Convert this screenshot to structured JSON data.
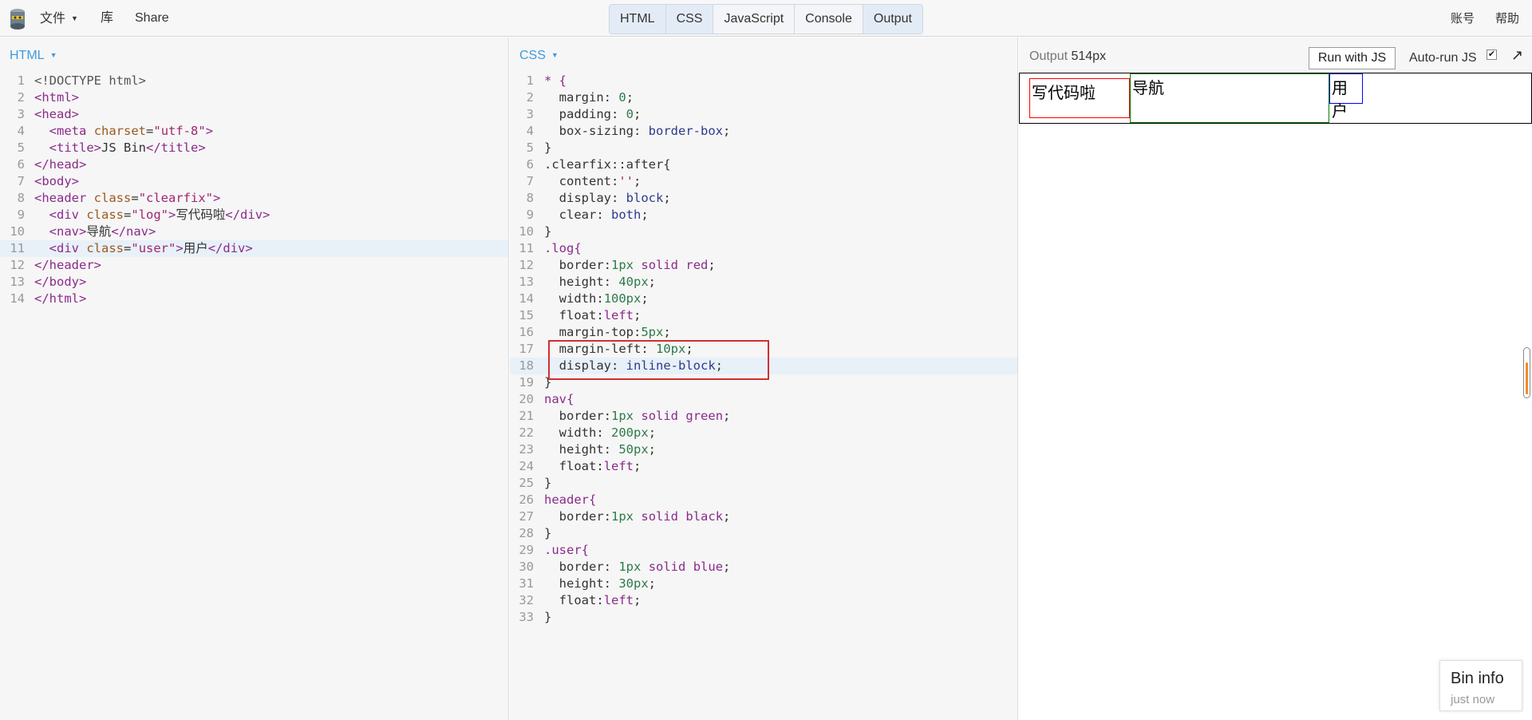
{
  "topbar": {
    "menu_file": "文件",
    "menu_library": "库",
    "menu_share": "Share",
    "tabs": [
      "HTML",
      "CSS",
      "JavaScript",
      "Console",
      "Output"
    ],
    "account": "账号",
    "help": "帮助",
    "logo_icon": "jsbin-logo-icon"
  },
  "html_panel": {
    "title": "HTML",
    "lines": [
      {
        "n": "1"
      },
      {
        "n": "2"
      },
      {
        "n": "3"
      },
      {
        "n": "4"
      },
      {
        "n": "5"
      },
      {
        "n": "6"
      },
      {
        "n": "7"
      },
      {
        "n": "8"
      },
      {
        "n": "9"
      },
      {
        "n": "10"
      },
      {
        "n": "11"
      },
      {
        "n": "12"
      },
      {
        "n": "13"
      },
      {
        "n": "14"
      }
    ],
    "code": {
      "l1": "<!DOCTYPE html>",
      "l2": "<html>",
      "l3": "<head>",
      "l4_tag": "<meta",
      "l4_attr": "charset",
      "l4_val": "\"utf-8\"",
      "l4_end": ">",
      "l5_open": "<title>",
      "l5_text": "JS Bin",
      "l5_close": "</title>",
      "l6": "</head>",
      "l7": "<body>",
      "l8_tag": "<header",
      "l8_attr": "class",
      "l8_val": "\"clearfix\"",
      "l8_end": ">",
      "l9_tag": "<div",
      "l9_attr": "class",
      "l9_val": "\"log\"",
      "l9_end": ">",
      "l9_text": "写代码啦",
      "l9_close": "</div>",
      "l10_open": "<nav>",
      "l10_text": "导航",
      "l10_close": "</nav>",
      "l11_tag": "<div",
      "l11_attr": "class",
      "l11_val": "\"user\"",
      "l11_end": ">",
      "l11_text": "用户",
      "l11_close": "</div>",
      "l12": "</header>",
      "l13": "</body>",
      "l14": "</html>"
    }
  },
  "css_panel": {
    "title": "CSS",
    "code": [
      "* {",
      "  margin: 0;",
      "  padding: 0;",
      "  box-sizing: border-box;",
      "}",
      ".clearfix::after{",
      "  content:'';",
      "  display: block;",
      "  clear: both;",
      "}",
      ".log{",
      "  border:1px solid red;",
      "  height: 40px;",
      "  width:100px;",
      "  float:left;",
      "  margin-top:5px;",
      "  margin-left: 10px;",
      "  display: inline-block;",
      "}",
      "nav{",
      "  border:1px solid green;",
      "  width: 200px;",
      "  height: 50px;",
      "  float:left;",
      "}",
      "header{",
      "  border:1px solid black;",
      "}",
      ".user{",
      "  border: 1px solid blue;",
      "  height: 30px;",
      "  float:left;",
      "}"
    ]
  },
  "output_panel": {
    "title_prefix": "Output",
    "width_label": "514px",
    "run_button": "Run with JS",
    "autorun_label": "Auto-run JS",
    "autorun_checked": "✔",
    "popout_icon": "↗",
    "demo": {
      "log": "写代码啦",
      "nav": "导航",
      "user": "用户"
    }
  },
  "bin_info": {
    "title": "Bin info",
    "sub": "just now"
  },
  "colors": {
    "accent": "#3d9be0",
    "annotation": "#d32f2f"
  }
}
